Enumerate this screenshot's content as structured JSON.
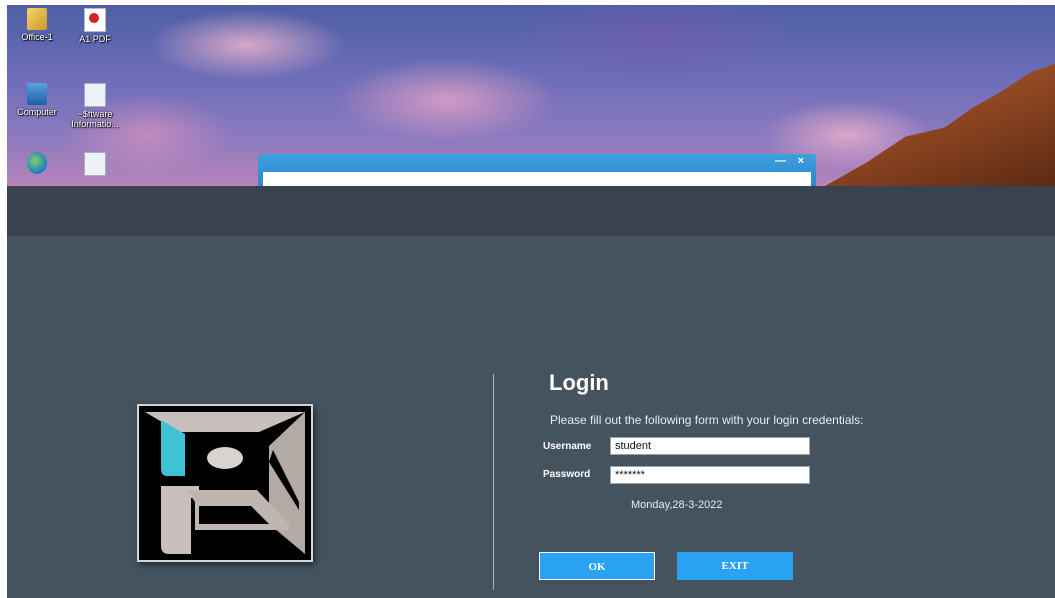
{
  "desktop": {
    "icons": [
      {
        "label": "Office-1",
        "icon": "folder-icon"
      },
      {
        "label": "A1 PDF",
        "icon": "pdf-icon"
      },
      {
        "label": "Computer",
        "icon": "computer-icon"
      },
      {
        "label": "~$ftware Informatio...",
        "icon": "document-icon"
      },
      {
        "label": "",
        "icon": "browser-icon"
      },
      {
        "label": "",
        "icon": "document-icon"
      }
    ],
    "dialog": {
      "minimize_glyph": "—",
      "close_glyph": "×"
    }
  },
  "login": {
    "title": "Login",
    "instructions": "Please fill out the following form with your login credentials:",
    "username_label": "Username",
    "username_value": "student",
    "password_label": "Password",
    "password_value": "*******",
    "date": "Monday,28-3-2022",
    "ok_label": "OK",
    "exit_label": "EXIT"
  },
  "colors": {
    "app_background": "#45535f",
    "app_header": "#38434f",
    "button": "#2aa2f2",
    "logo_accent": "#3ec3d6"
  }
}
